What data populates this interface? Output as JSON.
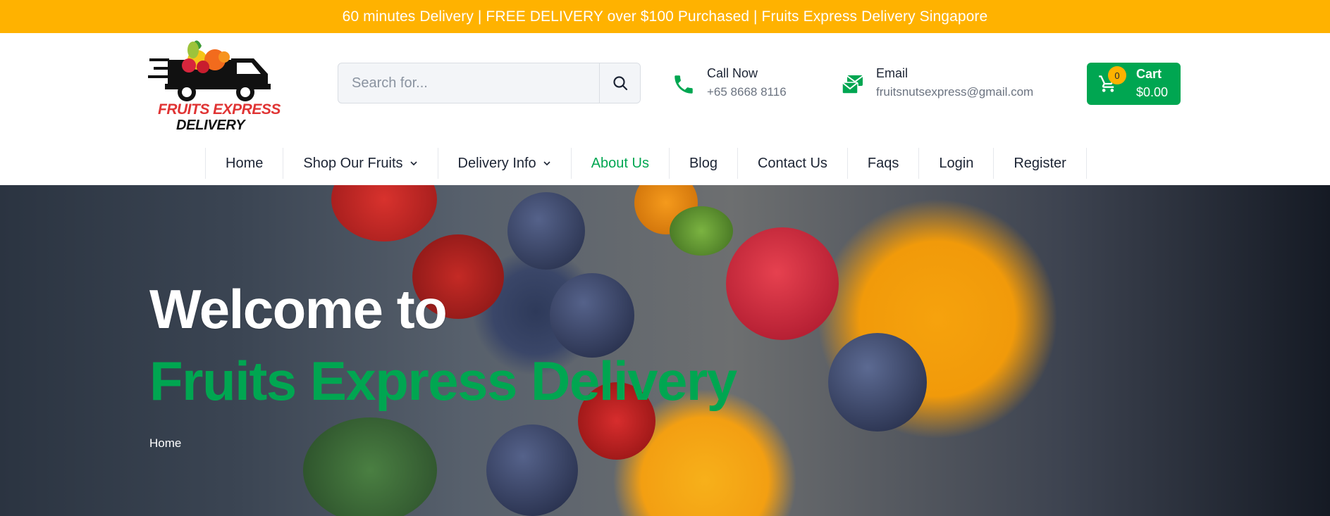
{
  "topbar": {
    "text": "60 minutes Delivery | FREE DELIVERY over $100 Purchased | Fruits Express Delivery Singapore"
  },
  "logo": {
    "line1": "FRUITS EXPRESS",
    "line2": "DELIVERY"
  },
  "search": {
    "placeholder": "Search for..."
  },
  "call": {
    "label": "Call Now",
    "value": "+65 8668 8116"
  },
  "email": {
    "label": "Email",
    "value": "fruitsnutsexpress@gmail.com"
  },
  "cart": {
    "label": "Cart",
    "total": "$0.00",
    "count": "0"
  },
  "nav": {
    "items": [
      {
        "label": "Home"
      },
      {
        "label": "Shop Our Fruits"
      },
      {
        "label": "Delivery Info"
      },
      {
        "label": "About Us"
      },
      {
        "label": "Blog"
      },
      {
        "label": "Contact Us"
      },
      {
        "label": "Faqs"
      },
      {
        "label": "Login"
      },
      {
        "label": "Register"
      }
    ]
  },
  "hero": {
    "title": "Welcome to",
    "subtitle": "Fruits Express Delivery",
    "breadcrumb": "Home"
  },
  "colors": {
    "accent": "#00a651",
    "topbar": "#ffb200",
    "text": "#1c2434"
  }
}
